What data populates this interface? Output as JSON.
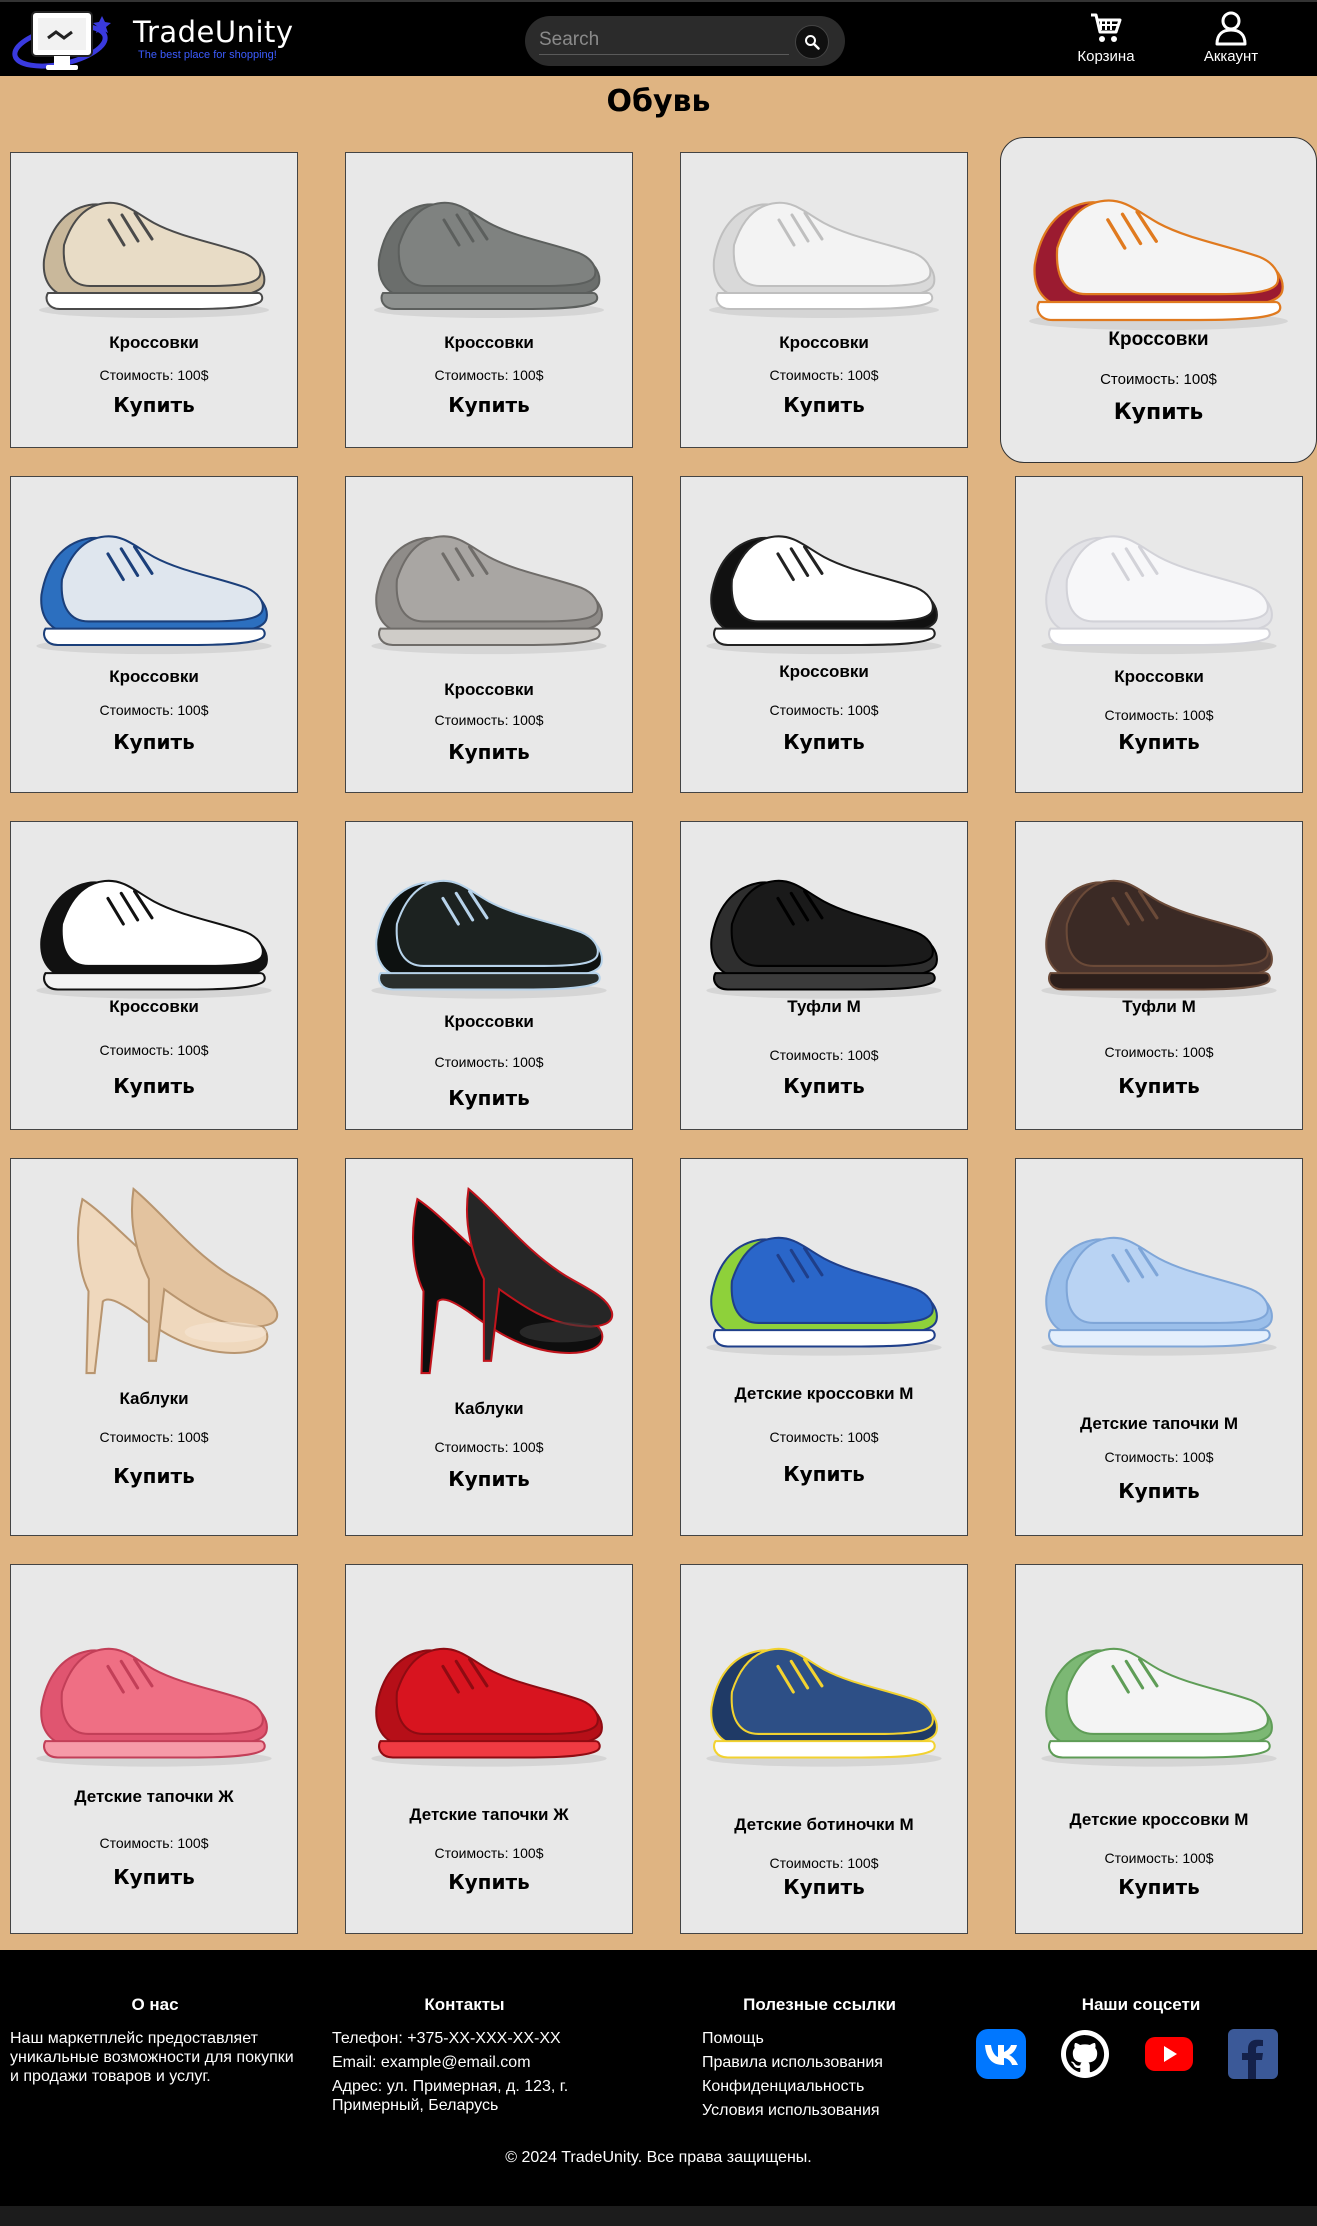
{
  "header": {
    "brand": "TradeUnity",
    "tagline": "The best place for shopping!",
    "search_placeholder": "Search",
    "cart_label": "Корзина",
    "account_label": "Аккаунт"
  },
  "page_title": "Обувь",
  "products": [
    {
      "name": "Кроссовки",
      "price": "Стоимость: 100$",
      "buy": "Купить",
      "image": "sneaker-beige"
    },
    {
      "name": "Кроссовки",
      "price": "Стоимость: 100$",
      "buy": "Купить",
      "image": "sneaker-grey"
    },
    {
      "name": "Кроссовки",
      "price": "Стоимость: 100$",
      "buy": "Купить",
      "image": "sneaker-white"
    },
    {
      "name": "Кроссовки",
      "price": "Стоимость: 100$",
      "buy": "Купить",
      "image": "sneaker-red-white"
    },
    {
      "name": "Кроссовки",
      "price": "Стоимость: 100$",
      "buy": "Купить",
      "image": "sneaker-blue"
    },
    {
      "name": "Кроссовки",
      "price": "Стоимость: 100$",
      "buy": "Купить",
      "image": "sneaker-grey-chunky"
    },
    {
      "name": "Кроссовки",
      "price": "Стоимость: 100$",
      "buy": "Купить",
      "image": "sneaker-black-white"
    },
    {
      "name": "Кроссовки",
      "price": "Стоимость: 100$",
      "buy": "Купить",
      "image": "sneaker-all-white"
    },
    {
      "name": "Кроссовки",
      "price": "Стоимость: 100$",
      "buy": "Купить",
      "image": "sneaker-panda"
    },
    {
      "name": "Кроссовки",
      "price": "Стоимость: 100$",
      "buy": "Купить",
      "image": "sneaker-black-high"
    },
    {
      "name": "Туфли М",
      "price": "Стоимость: 100$",
      "buy": "Купить",
      "image": "shoe-black-derby"
    },
    {
      "name": "Туфли М",
      "price": "Стоимость: 100$",
      "buy": "Купить",
      "image": "shoe-brown-derby"
    },
    {
      "name": "Каблуки",
      "price": "Стоимость: 100$",
      "buy": "Купить",
      "image": "heels-beige"
    },
    {
      "name": "Каблуки",
      "price": "Стоимость: 100$",
      "buy": "Купить",
      "image": "heels-black"
    },
    {
      "name": "Детские кроссовки М",
      "price": "Стоимость: 100$",
      "buy": "Купить",
      "image": "kids-sneaker-blue-green"
    },
    {
      "name": "Детские тапочки М",
      "price": "Стоимость: 100$",
      "buy": "Купить",
      "image": "kids-slipper-light-blue"
    },
    {
      "name": "Детские тапочки Ж",
      "price": "Стоимость: 100$",
      "buy": "Купить",
      "image": "kids-moccasin-pink"
    },
    {
      "name": "Детские тапочки Ж",
      "price": "Стоимость: 100$",
      "buy": "Купить",
      "image": "kids-shoe-red"
    },
    {
      "name": "Детские ботиночки М",
      "price": "Стоимость: 100$",
      "buy": "Купить",
      "image": "kids-boot-denim"
    },
    {
      "name": "Детские кроссовки М",
      "price": "Стоимость: 100$",
      "buy": "Купить",
      "image": "kids-sneaker-green-white"
    }
  ],
  "footer": {
    "about_title": "О нас",
    "about_text": "Наш маркетплейс предоставляет уникальные возможности для покупки и продажи товаров и услуг.",
    "contacts_title": "Контакты",
    "phone": "Телефон: +375-XX-XXX-XX-XX",
    "email": "Email: example@email.com",
    "address": "Адрес: ул. Примерная, д. 123, г. Примерный, Беларусь",
    "links_title": "Полезные ссылки",
    "links": [
      "Помощь",
      "Правила использования",
      "Конфиденциальность",
      "Условия использования"
    ],
    "social_title": "Наши соцсети",
    "socials": [
      "vk-icon",
      "github-icon",
      "youtube-icon",
      "facebook-icon"
    ],
    "copyright": "© 2024 TradeUnity. Все права защищены."
  },
  "colors": {
    "background": "#dfb482",
    "header": "#000000",
    "card": "#e8e8e8",
    "accent": "#3c5cff"
  }
}
